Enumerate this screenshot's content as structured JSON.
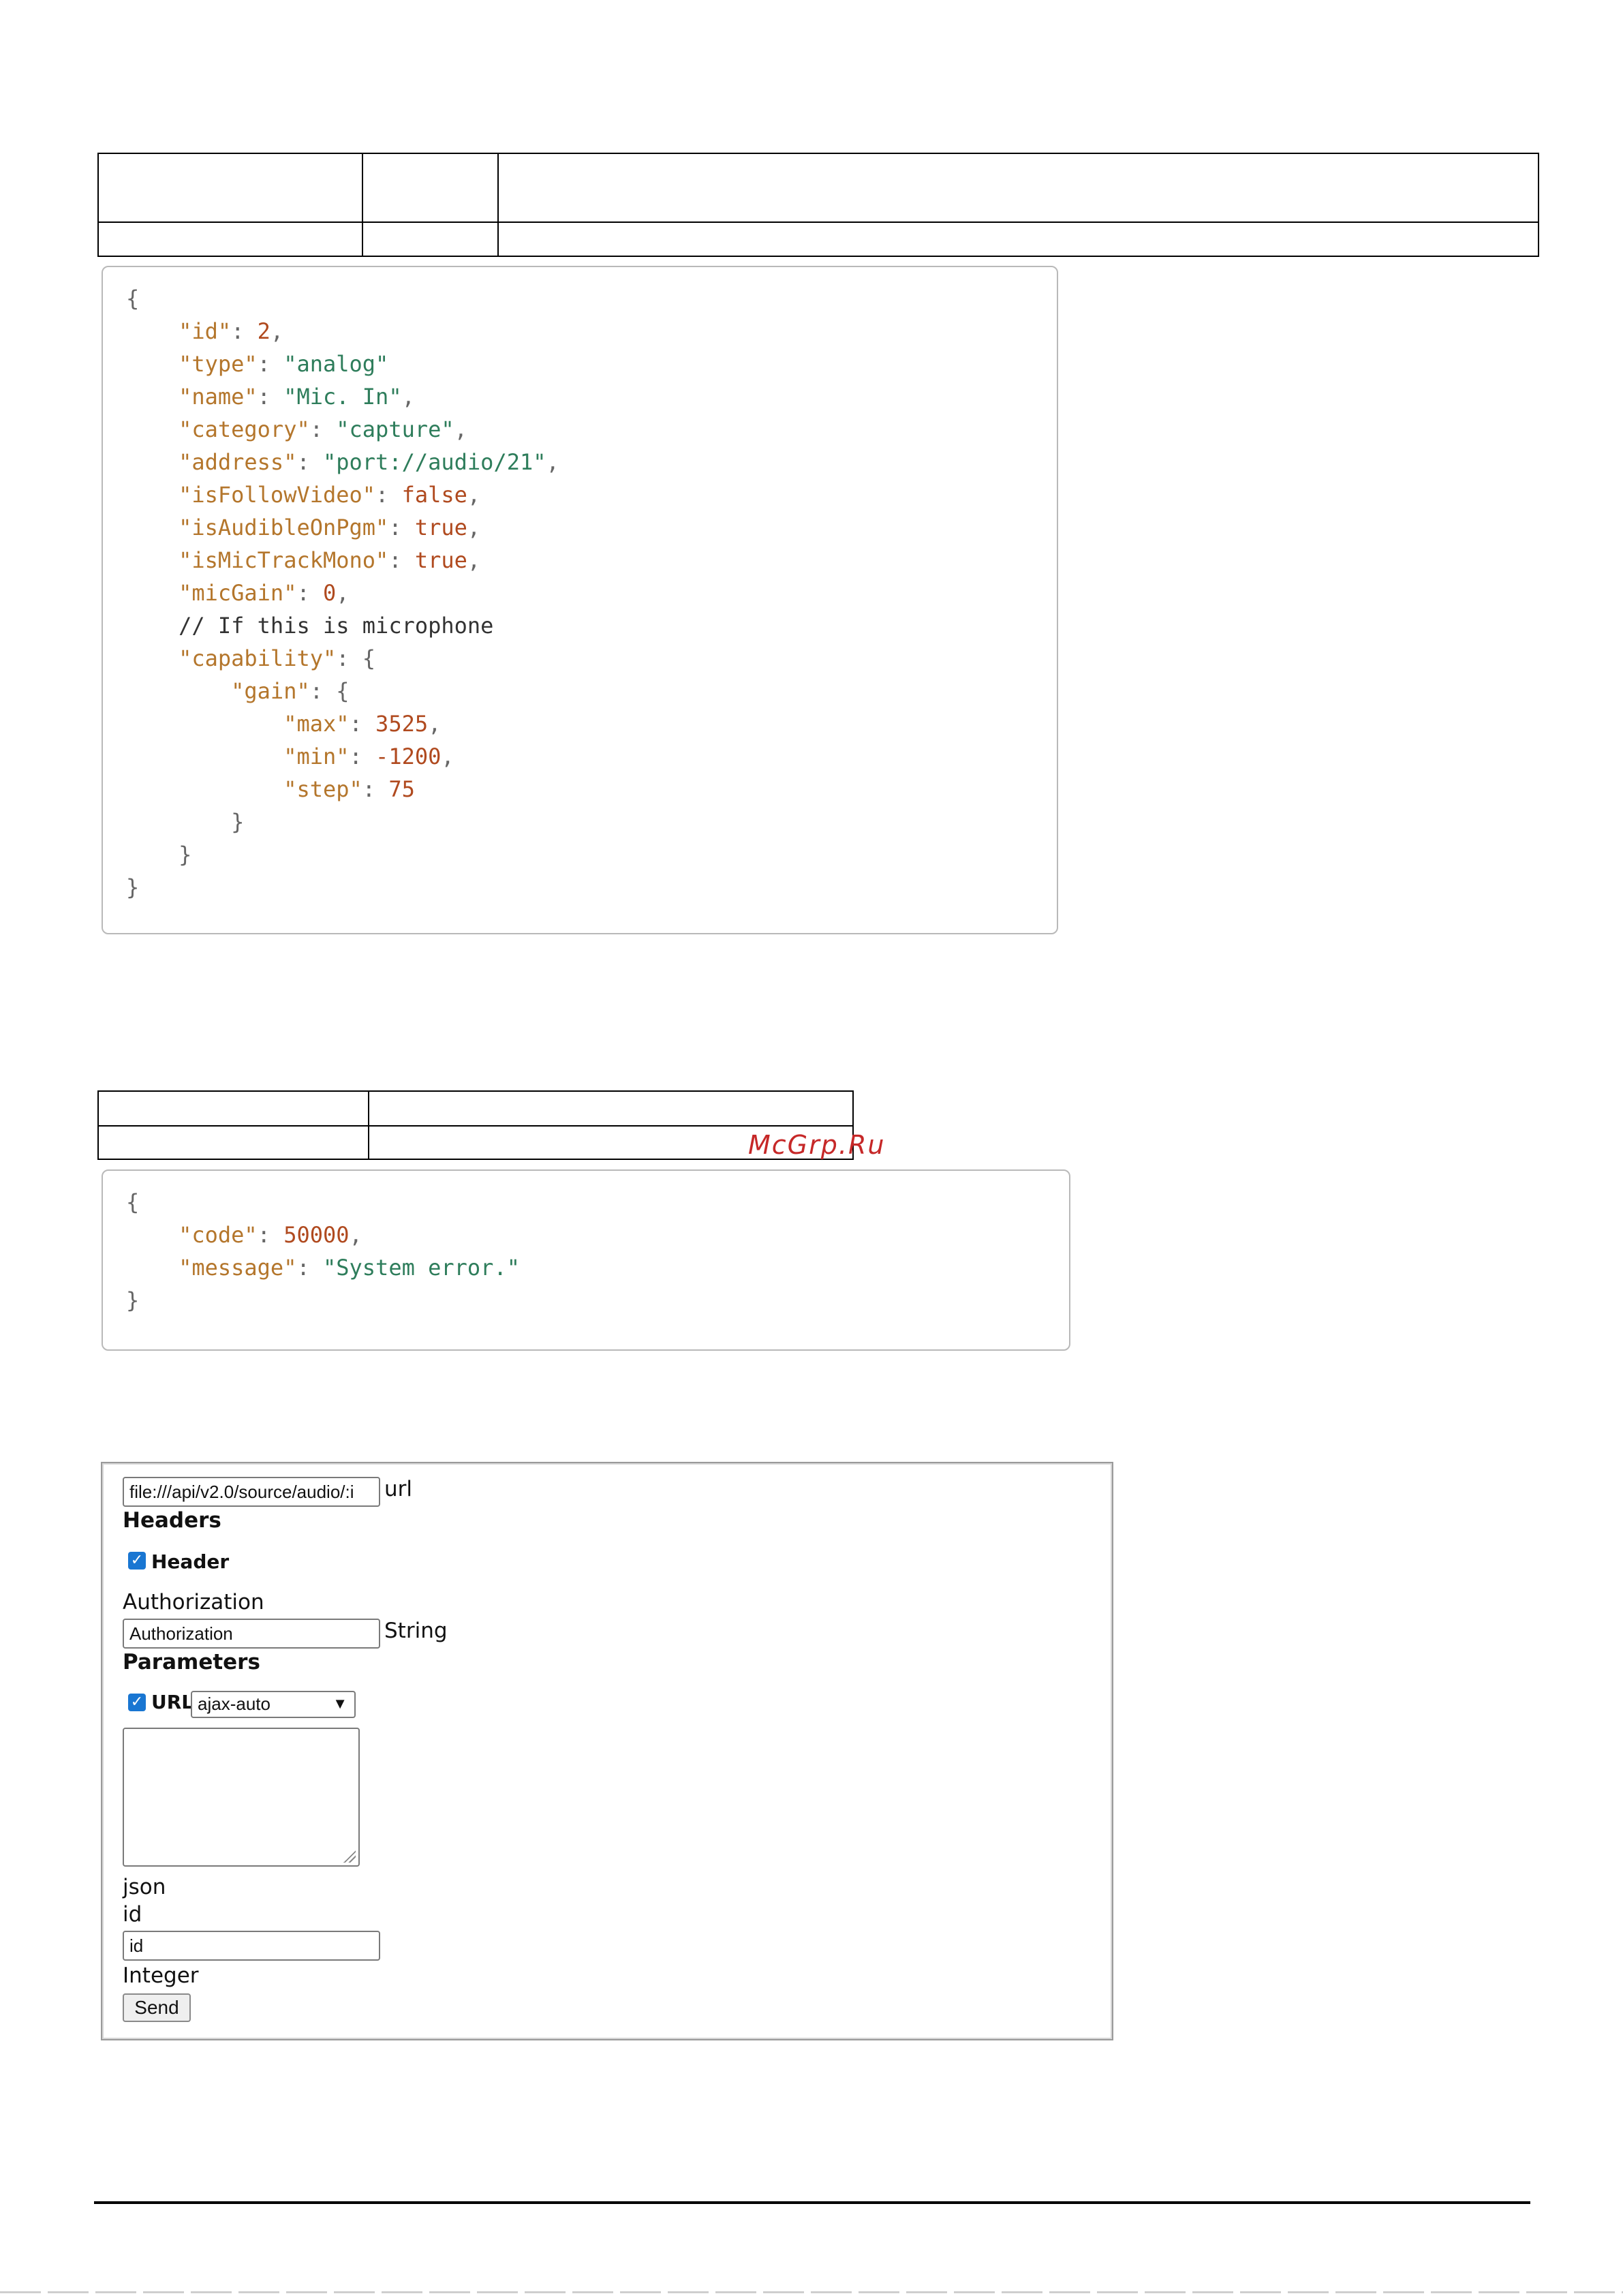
{
  "response_table_top": {
    "rows": [
      [
        "",
        "",
        ""
      ],
      [
        "",
        "",
        ""
      ]
    ]
  },
  "success_json": [
    [
      [
        "p",
        "{"
      ]
    ],
    [
      [
        "p",
        "    "
      ],
      [
        "k",
        "\"id\""
      ],
      [
        "p",
        ": "
      ],
      [
        "n",
        "2"
      ],
      [
        "p",
        ","
      ]
    ],
    [
      [
        "p",
        "    "
      ],
      [
        "k",
        "\"type\""
      ],
      [
        "p",
        ": "
      ],
      [
        "s",
        "\"analog\""
      ]
    ],
    [
      [
        "p",
        "    "
      ],
      [
        "k",
        "\"name\""
      ],
      [
        "p",
        ": "
      ],
      [
        "s",
        "\"Mic. In\""
      ],
      [
        "p",
        ","
      ]
    ],
    [
      [
        "p",
        "    "
      ],
      [
        "k",
        "\"category\""
      ],
      [
        "p",
        ": "
      ],
      [
        "s",
        "\"capture\""
      ],
      [
        "p",
        ","
      ]
    ],
    [
      [
        "p",
        "    "
      ],
      [
        "k",
        "\"address\""
      ],
      [
        "p",
        ": "
      ],
      [
        "s",
        "\"port://audio/21\""
      ],
      [
        "p",
        ","
      ]
    ],
    [
      [
        "p",
        "    "
      ],
      [
        "k",
        "\"isFollowVideo\""
      ],
      [
        "p",
        ": "
      ],
      [
        "n",
        "false"
      ],
      [
        "p",
        ","
      ]
    ],
    [
      [
        "p",
        "    "
      ],
      [
        "k",
        "\"isAudibleOnPgm\""
      ],
      [
        "p",
        ": "
      ],
      [
        "n",
        "true"
      ],
      [
        "p",
        ","
      ]
    ],
    [
      [
        "p",
        "    "
      ],
      [
        "k",
        "\"isMicTrackMono\""
      ],
      [
        "p",
        ": "
      ],
      [
        "n",
        "true"
      ],
      [
        "p",
        ","
      ]
    ],
    [
      [
        "p",
        "    "
      ],
      [
        "k",
        "\"micGain\""
      ],
      [
        "p",
        ": "
      ],
      [
        "n",
        "0"
      ],
      [
        "p",
        ","
      ]
    ],
    [
      [
        "p",
        "    "
      ],
      [
        "c",
        "// If this is microphone"
      ]
    ],
    [
      [
        "p",
        "    "
      ],
      [
        "k",
        "\"capability\""
      ],
      [
        "p",
        ": {"
      ]
    ],
    [
      [
        "p",
        "        "
      ],
      [
        "k",
        "\"gain\""
      ],
      [
        "p",
        ": {"
      ]
    ],
    [
      [
        "p",
        "            "
      ],
      [
        "k",
        "\"max\""
      ],
      [
        "p",
        ": "
      ],
      [
        "n",
        "3525"
      ],
      [
        "p",
        ","
      ]
    ],
    [
      [
        "p",
        "            "
      ],
      [
        "k",
        "\"min\""
      ],
      [
        "p",
        ": "
      ],
      [
        "n",
        "-1200"
      ],
      [
        "p",
        ","
      ]
    ],
    [
      [
        "p",
        "            "
      ],
      [
        "k",
        "\"step\""
      ],
      [
        "p",
        ": "
      ],
      [
        "n",
        "75"
      ]
    ],
    [
      [
        "p",
        "        }"
      ]
    ],
    [
      [
        "p",
        "    }"
      ]
    ],
    [
      [
        "p",
        "}"
      ]
    ]
  ],
  "error_table": {
    "rows": [
      [
        "",
        ""
      ],
      [
        "",
        ""
      ]
    ]
  },
  "watermark": "McGrp.Ru",
  "error_json": [
    [
      [
        "p",
        "{"
      ]
    ],
    [
      [
        "p",
        "    "
      ],
      [
        "k",
        "\"code\""
      ],
      [
        "p",
        ": "
      ],
      [
        "n",
        "50000"
      ],
      [
        "p",
        ","
      ]
    ],
    [
      [
        "p",
        "    "
      ],
      [
        "k",
        "\"message\""
      ],
      [
        "p",
        ": "
      ],
      [
        "s",
        "\"System error.\""
      ]
    ],
    [
      [
        "p",
        "}"
      ]
    ]
  ],
  "form": {
    "url_value": "file:///api/v2.0/source/audio/:i",
    "url_label": "url",
    "headers_title": "Headers",
    "header_checkbox_label": "Header",
    "authorization_label": "Authorization",
    "authorization_placeholder": "Authorization",
    "authorization_type": "String",
    "parameters_title": "Parameters",
    "url_checkbox_label": "URL",
    "ajax_selected": "ajax-auto",
    "body_type_label": "json",
    "id_label": "id",
    "id_placeholder": "id",
    "id_type": "Integer",
    "send_label": "Send"
  }
}
